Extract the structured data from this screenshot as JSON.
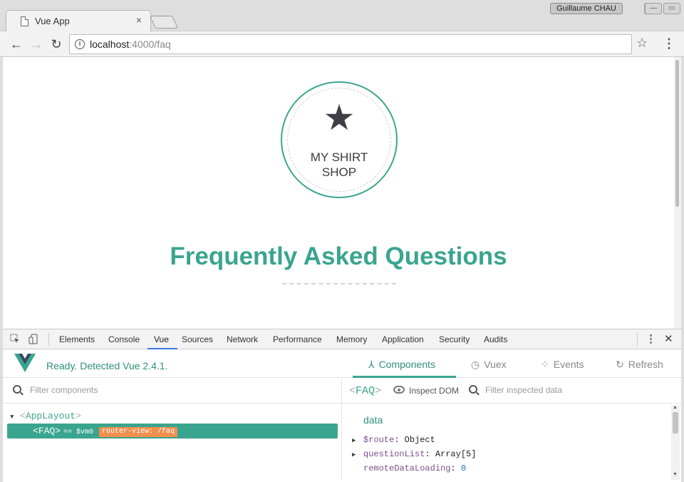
{
  "browser": {
    "tab_title": "Vue App",
    "tab_close": "×",
    "profile_name": "Guillaume CHAU",
    "url_host": "localhost",
    "url_path": ":4000/faq",
    "back_glyph": "←",
    "forward_glyph": "→",
    "reload_glyph": "↻",
    "star_glyph": "☆",
    "menu_glyph": "⋮",
    "info_glyph": "i",
    "win_minimize": "—",
    "win_restore": "▭",
    "win_close": "✕"
  },
  "page": {
    "logo_star": "★",
    "logo_text": "MY SHIRT\nSHOP",
    "heading": "Frequently Asked Questions",
    "accent_color": "#3aa58f"
  },
  "devtools": {
    "tabs": [
      "Elements",
      "Console",
      "Vue",
      "Sources",
      "Network",
      "Performance",
      "Memory",
      "Application",
      "Security",
      "Audits"
    ],
    "active_tab": "Vue",
    "kebab": "⋮",
    "close": "✕"
  },
  "vue": {
    "status": "Ready. Detected Vue 2.4.1.",
    "tabs": {
      "components": "Components",
      "vuex": "Vuex",
      "events": "Events",
      "refresh": "Refresh"
    },
    "tab_icons": {
      "components": "⅄",
      "vuex": "◷",
      "events": "⁘",
      "refresh": "↻"
    },
    "filter_components_placeholder": "Filter components",
    "tree": {
      "root_name": "AppLayout",
      "child_name": "FAQ",
      "child_vm": "== $vm0",
      "child_badge": "router-view: /faq"
    },
    "inspector": {
      "component_name": "FAQ",
      "inspect_dom": "Inspect DOM",
      "filter_data_placeholder": "Filter inspected data",
      "section": "data",
      "rows": [
        {
          "key": "$route",
          "value": "Object",
          "expandable": true
        },
        {
          "key": "questionList",
          "value": "Array[5]",
          "expandable": true
        },
        {
          "key": "remoteDataLoading",
          "value": "0",
          "expandable": false
        }
      ]
    }
  }
}
